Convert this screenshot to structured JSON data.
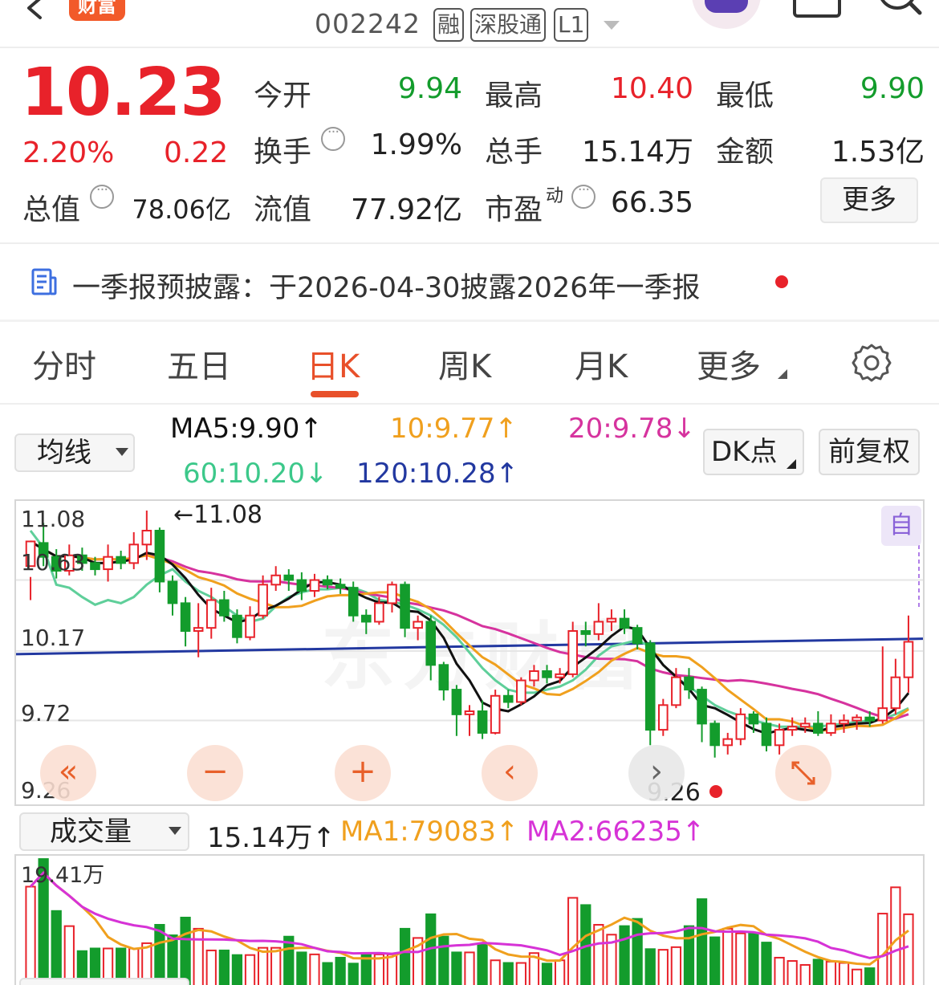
{
  "header": {
    "brand_badge": "财富",
    "stock_code": "002242",
    "tags": [
      "融",
      "深股通",
      "L1"
    ]
  },
  "quote": {
    "price": "10.23",
    "change_pct": "2.20%",
    "change": "0.22",
    "open_label": "今开",
    "open": "9.94",
    "high_label": "最高",
    "high": "10.40",
    "low_label": "最低",
    "low": "9.90",
    "turnover_label": "换手",
    "turnover": "1.99%",
    "volume_label": "总手",
    "volume": "15.14万",
    "amount_label": "金额",
    "amount": "1.53亿",
    "mktcap_label": "总值",
    "mktcap": "78.06亿",
    "float_label": "流值",
    "float_cap": "77.92亿",
    "pe_label": "市盈",
    "pe_sup": "动",
    "pe": "66.35",
    "more_label": "更多"
  },
  "notice": {
    "text": "一季报预披露：于2026-04-30披露2026年一季报"
  },
  "tabs": [
    "分时",
    "五日",
    "日K",
    "周K",
    "月K",
    "更多"
  ],
  "indicator": {
    "selector": "均线",
    "ma5": "MA5:9.90↑",
    "ma10": "10:9.77↑",
    "ma20": "20:9.78↓",
    "ma60": "60:10.20↓",
    "ma120": "120:10.28↑",
    "dk_label": "DK点",
    "adjust_label": "前复权"
  },
  "kline": {
    "y_labels": [
      "11.08",
      "10.63",
      "10.17",
      "9.72",
      "9.26"
    ],
    "high_marker": "←11.08",
    "low_marker": "9.26",
    "auto_label": "自",
    "watermark": "东方财富",
    "controls": [
      "«",
      "−",
      "+",
      "‹",
      "›"
    ],
    "colors": {
      "up": "#e8222a",
      "down": "#139c2c",
      "ma5": "#111111",
      "ma10": "#f0a01e",
      "ma20": "#d6339e",
      "ma60": "#5fcf9a",
      "ma120": "#2238a0"
    },
    "candles": [
      [
        10.72,
        10.88,
        10.5,
        10.65,
        10.95
      ],
      [
        10.87,
        10.78,
        10.72,
        11.0,
        10.84
      ],
      [
        10.78,
        10.69,
        10.64,
        10.83,
        10.6
      ],
      [
        10.69,
        10.79,
        10.66,
        10.86,
        10.58
      ],
      [
        10.79,
        10.74,
        10.69,
        10.84,
        10.52
      ],
      [
        10.74,
        10.7,
        10.66,
        10.78,
        10.47
      ],
      [
        10.7,
        10.78,
        10.62,
        10.86,
        10.5
      ],
      [
        10.78,
        10.74,
        10.7,
        10.82,
        10.48
      ],
      [
        10.74,
        10.86,
        10.7,
        10.94,
        10.52
      ],
      [
        10.86,
        10.95,
        10.76,
        11.08,
        10.6
      ],
      [
        10.95,
        10.62,
        10.55,
        10.97,
        10.66
      ],
      [
        10.62,
        10.48,
        10.4,
        10.66,
        10.7
      ],
      [
        10.48,
        10.3,
        10.2,
        10.52,
        10.62
      ],
      [
        10.3,
        10.32,
        10.13,
        10.48,
        10.56
      ],
      [
        10.32,
        10.5,
        10.25,
        10.58,
        10.52
      ],
      [
        10.5,
        10.4,
        10.36,
        10.56,
        10.46
      ],
      [
        10.4,
        10.26,
        10.22,
        10.44,
        10.4
      ],
      [
        10.26,
        10.4,
        10.24,
        10.46,
        10.36
      ],
      [
        10.4,
        10.6,
        10.38,
        10.66,
        10.38
      ],
      [
        10.6,
        10.66,
        10.56,
        10.72,
        10.46
      ],
      [
        10.66,
        10.63,
        10.56,
        10.7,
        10.52
      ],
      [
        10.63,
        10.56,
        10.5,
        10.68,
        10.55
      ],
      [
        10.56,
        10.63,
        10.52,
        10.67,
        10.57
      ],
      [
        10.63,
        10.6,
        10.57,
        10.66,
        10.57
      ],
      [
        10.6,
        10.58,
        10.54,
        10.64,
        10.58
      ],
      [
        10.58,
        10.4,
        10.36,
        10.62,
        10.58
      ],
      [
        10.4,
        10.36,
        10.28,
        10.44,
        10.55
      ],
      [
        10.36,
        10.48,
        10.34,
        10.52,
        10.5
      ],
      [
        10.48,
        10.6,
        10.42,
        10.62,
        10.49
      ],
      [
        10.6,
        10.32,
        10.26,
        10.62,
        10.47
      ],
      [
        10.32,
        10.36,
        10.24,
        10.4,
        10.44
      ],
      [
        10.36,
        10.08,
        9.98,
        10.4,
        10.4
      ],
      [
        10.08,
        9.92,
        9.85,
        10.1,
        10.34
      ],
      [
        9.92,
        9.76,
        9.62,
        9.95,
        10.26
      ],
      [
        9.76,
        9.78,
        9.62,
        9.82,
        10.16
      ],
      [
        9.78,
        9.64,
        9.6,
        9.85,
        10.06
      ],
      [
        9.64,
        9.88,
        9.63,
        9.92,
        9.98
      ],
      [
        9.88,
        9.84,
        9.8,
        9.92,
        9.92
      ],
      [
        9.84,
        9.98,
        9.82,
        10.0,
        9.9
      ],
      [
        9.98,
        10.04,
        9.94,
        10.08,
        9.9
      ],
      [
        10.04,
        10.0,
        9.96,
        10.08,
        9.92
      ],
      [
        10.0,
        10.02,
        9.96,
        10.06,
        9.94
      ],
      [
        10.02,
        10.3,
        10.0,
        10.36,
        9.98
      ],
      [
        10.3,
        10.28,
        10.2,
        10.36,
        10.05
      ],
      [
        10.28,
        10.36,
        10.24,
        10.48,
        10.14
      ],
      [
        10.36,
        10.38,
        10.3,
        10.44,
        10.2
      ],
      [
        10.38,
        10.32,
        10.28,
        10.44,
        10.22
      ],
      [
        10.32,
        10.22,
        10.18,
        10.34,
        10.24
      ],
      [
        10.22,
        9.66,
        9.56,
        10.24,
        10.2
      ],
      [
        9.66,
        9.82,
        9.62,
        9.86,
        10.08
      ],
      [
        9.82,
        10.0,
        9.8,
        10.06,
        10.0
      ],
      [
        10.0,
        9.92,
        9.86,
        10.06,
        9.94
      ],
      [
        9.92,
        9.7,
        9.58,
        9.94,
        9.88
      ],
      [
        9.7,
        9.56,
        9.48,
        9.72,
        9.82
      ],
      [
        9.56,
        9.6,
        9.5,
        9.64,
        9.78
      ],
      [
        9.6,
        9.76,
        9.56,
        9.8,
        9.75
      ],
      [
        9.76,
        9.7,
        9.64,
        9.78,
        9.72
      ],
      [
        9.7,
        9.56,
        9.52,
        9.74,
        9.7
      ],
      [
        9.56,
        9.66,
        9.5,
        9.7,
        9.68
      ],
      [
        9.66,
        9.68,
        9.62,
        9.74,
        9.68
      ],
      [
        9.68,
        9.7,
        9.64,
        9.74,
        9.68
      ],
      [
        9.7,
        9.64,
        9.62,
        9.78,
        9.68
      ],
      [
        9.64,
        9.7,
        9.62,
        9.76,
        9.69
      ],
      [
        9.7,
        9.72,
        9.64,
        9.76,
        9.7
      ],
      [
        9.72,
        9.74,
        9.66,
        9.76,
        9.71
      ],
      [
        9.74,
        9.72,
        9.68,
        9.78,
        9.72
      ],
      [
        9.72,
        9.8,
        9.7,
        10.2,
        9.73
      ],
      [
        9.8,
        10.0,
        9.76,
        10.12,
        9.76
      ],
      [
        10.0,
        10.23,
        9.9,
        10.4,
        9.8
      ]
    ]
  },
  "volume": {
    "selector": "成交量",
    "value": "15.14万↑",
    "ma1": "MA1:79083↑",
    "ma2": "MA2:66235↑",
    "y_label": "19.41万",
    "bars": [
      15.2,
      19.4,
      11.5,
      9.2,
      5.4,
      5.8,
      5.8,
      5.8,
      5.8,
      6.6,
      9.4,
      7.8,
      10.5,
      8.8,
      5.5,
      5.5,
      4.8,
      4.8,
      5.9,
      5.9,
      7.6,
      5.2,
      4.9,
      3.6,
      4.4,
      3.5,
      5.0,
      4.9,
      4.9,
      8.8,
      7.4,
      11.0,
      7.6,
      5.2,
      5.2,
      6.4,
      4.0,
      3.6,
      3.6,
      5.1,
      3.5,
      4.0,
      13.5,
      12.4,
      9.4,
      7.9,
      9.2,
      10.3,
      5.7,
      5.6,
      6.0,
      9.2,
      13.3,
      7.5,
      8.8,
      8.1,
      8.2,
      6.7,
      4.4,
      3.9,
      3.3,
      4.1,
      3.8,
      3.6,
      2.6,
      2.8,
      11.1,
      15.1,
      11.0
    ],
    "colors": {
      "up": "#e8222a",
      "down": "#139c2c",
      "ma1": "#f0a01e",
      "ma2": "#d633d6"
    }
  }
}
